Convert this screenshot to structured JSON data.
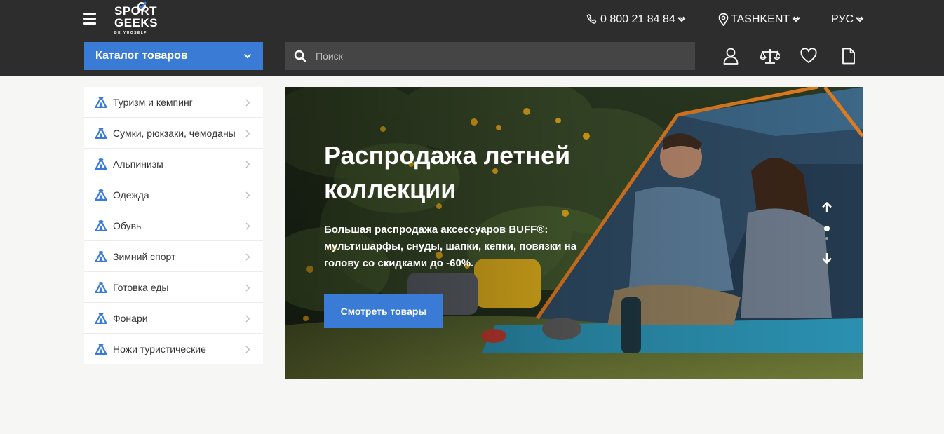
{
  "header": {
    "logo_line1": "SPORT",
    "logo_line2": "GEEKS",
    "logo_tagline": "BE YUOSELF",
    "phone": "0 800 21 84 84",
    "city": "TASHKENT",
    "language": "РУС",
    "catalog_label": "Каталог товаров",
    "search_placeholder": "Поиск",
    "icons": [
      "burger-menu-icon",
      "phone-icon",
      "location-pin-icon",
      "search-icon",
      "user-icon",
      "compare-scales-icon",
      "heart-icon",
      "document-icon"
    ]
  },
  "sidebar": {
    "items": [
      {
        "label": "Туризм и кемпинг"
      },
      {
        "label": "Сумки, рюкзаки, чемоданы"
      },
      {
        "label": "Альпинизм"
      },
      {
        "label": "Одежда"
      },
      {
        "label": "Обувь"
      },
      {
        "label": "Зимний спорт"
      },
      {
        "label": "Готовка еды"
      },
      {
        "label": "Фонари"
      },
      {
        "label": "Ножи туристические"
      }
    ]
  },
  "banner": {
    "title": "Распродажа летней коллекции",
    "text": "Большая распродажа аксессуаров BUFF®: мультишарфы, снуды, шапки, кепки, повязки на голову со скидками до -60%.",
    "button_label": "Смотреть товары",
    "active_slide": 1,
    "slide_count": 2
  },
  "colors": {
    "header_bg": "#2d2d2d",
    "accent": "#3a7bd5",
    "search_bg": "#454545",
    "page_bg": "#f6f6f4"
  }
}
